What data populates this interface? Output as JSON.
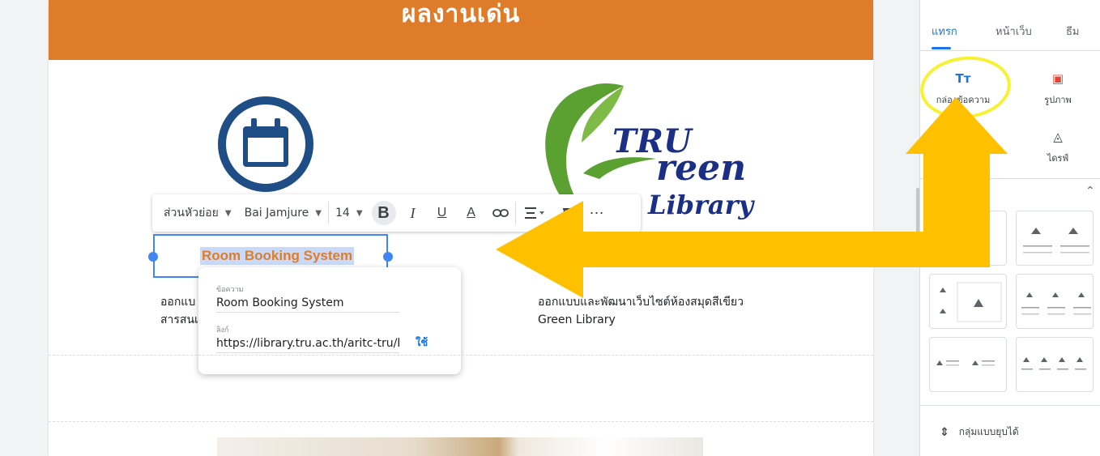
{
  "banner": {
    "title": "ผลงานเด่น"
  },
  "toolbar": {
    "style_select": "ส่วนหัวย่อย",
    "font_select": "Bai Jamjure",
    "size_select": "14",
    "bold": "B",
    "italic": "I",
    "underline": "U",
    "text_color": "A",
    "more": "⋯"
  },
  "selected_text": "Room Booking System",
  "link_popup": {
    "text_label": "ข้อความ",
    "text_value": "Room Booking System",
    "link_label": "ลิงก์",
    "link_value": "https://library.tru.ac.th/aritc-tru/bo...",
    "apply": "ใช้"
  },
  "left_desc": {
    "line1": "ออกแบ",
    "line2": "สารสนเ"
  },
  "right_desc": {
    "line1": "ออกแบบและพัฒนาเว็บไซต์ห้องสมุดสีเขียว",
    "line2": "Green Library"
  },
  "logo": {
    "line1": "TRU",
    "line2": "reen",
    "line3": "Library"
  },
  "sidebar": {
    "tabs": [
      {
        "label": "แทรก",
        "active": true
      },
      {
        "label": "หน้าเว็บ",
        "active": false
      },
      {
        "label": "ธีม",
        "active": false
      }
    ],
    "insert_items": [
      {
        "label": "กล่องข้อความ",
        "icon": "text-box-icon",
        "glyph": "Tт"
      },
      {
        "label": "รูปภาพ",
        "icon": "image-icon",
        "glyph": "▣"
      },
      {
        "label": "ไดรฟ์",
        "icon": "drive-icon",
        "glyph": "◬"
      }
    ],
    "section_label": "บ",
    "collapsible_group": "กลุ่มแบบยุบได้"
  },
  "colors": {
    "banner": "#de7c2a",
    "accent": "#1a73e8",
    "arrow": "#ffc000",
    "highlight": "#f7f22e"
  }
}
